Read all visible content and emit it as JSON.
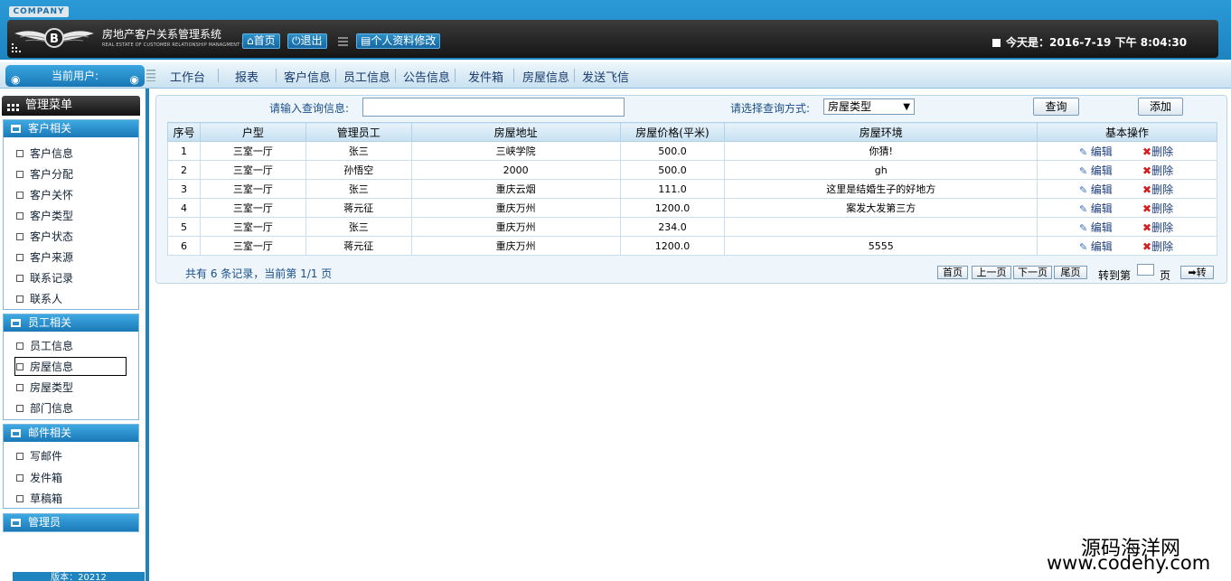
{
  "header": {
    "company": "COMPANY",
    "system_title": "房地产客户关系管理系统",
    "system_title_en": "REAL ESTATE OF CUSTOMER RELATIONSHIP MANAGMENT SYSTEM",
    "home": "首页",
    "logout": "退出",
    "profile": "个人资料修改",
    "date_label": "今天是：2016-7-19 下午 8:04:30"
  },
  "nav": {
    "current_user": "当前用户:",
    "items": [
      "工作台",
      "报表",
      "客户信息",
      "员工信息",
      "公告信息",
      "发件箱",
      "房屋信息",
      "发送飞信"
    ]
  },
  "sidebar": {
    "title": "管理菜单",
    "sections": [
      {
        "title": "客户相关",
        "items": [
          "客户信息",
          "客户分配",
          "客户关怀",
          "客户类型",
          "客户状态",
          "客户来源",
          "联系记录",
          "联系人"
        ]
      },
      {
        "title": "员工相关",
        "items": [
          "员工信息",
          "房屋信息",
          "房屋类型",
          "部门信息"
        ]
      },
      {
        "title": "邮件相关",
        "items": [
          "写邮件",
          "发件箱",
          "草稿箱"
        ]
      },
      {
        "title": "管理员",
        "items": []
      }
    ],
    "version": "版本：20212"
  },
  "search": {
    "input_label": "请输入查询信息:",
    "input_value": "",
    "select_label": "请选择查询方式:",
    "select_value": "房屋类型",
    "query_button": "查询",
    "add_button": "添加"
  },
  "table": {
    "headers": [
      "序号",
      "户型",
      "管理员工",
      "房屋地址",
      "房屋价格(平米)",
      "房屋环境",
      "基本操作"
    ],
    "rows": [
      [
        "1",
        "三室一厅",
        "张三",
        "三峡学院",
        "500.0",
        "你猜!"
      ],
      [
        "2",
        "三室一厅",
        "孙悟空",
        "2000",
        "500.0",
        "gh"
      ],
      [
        "3",
        "三室一厅",
        "张三",
        "重庆云烟",
        "111.0",
        "这里是结婚生子的好地方"
      ],
      [
        "4",
        "三室一厅",
        "蒋元征",
        "重庆万州",
        "1200.0",
        "案发大发第三方"
      ],
      [
        "5",
        "三室一厅",
        "张三",
        "重庆万州",
        "234.0",
        ""
      ],
      [
        "6",
        "三室一厅",
        "蒋元征",
        "重庆万州",
        "1200.0",
        "5555"
      ]
    ],
    "edit_label": "编辑",
    "delete_label": "删除"
  },
  "pagination": {
    "summary": "共有 6 条记录，当前第 1/1 页",
    "first": "首页",
    "prev": "上一页",
    "next": "下一页",
    "last": "尾页",
    "goto_label": "转到第",
    "page_unit": "页",
    "go_button": "➡转"
  },
  "watermark": {
    "line1": "源码海洋网",
    "line2": "www.codehy.com"
  }
}
